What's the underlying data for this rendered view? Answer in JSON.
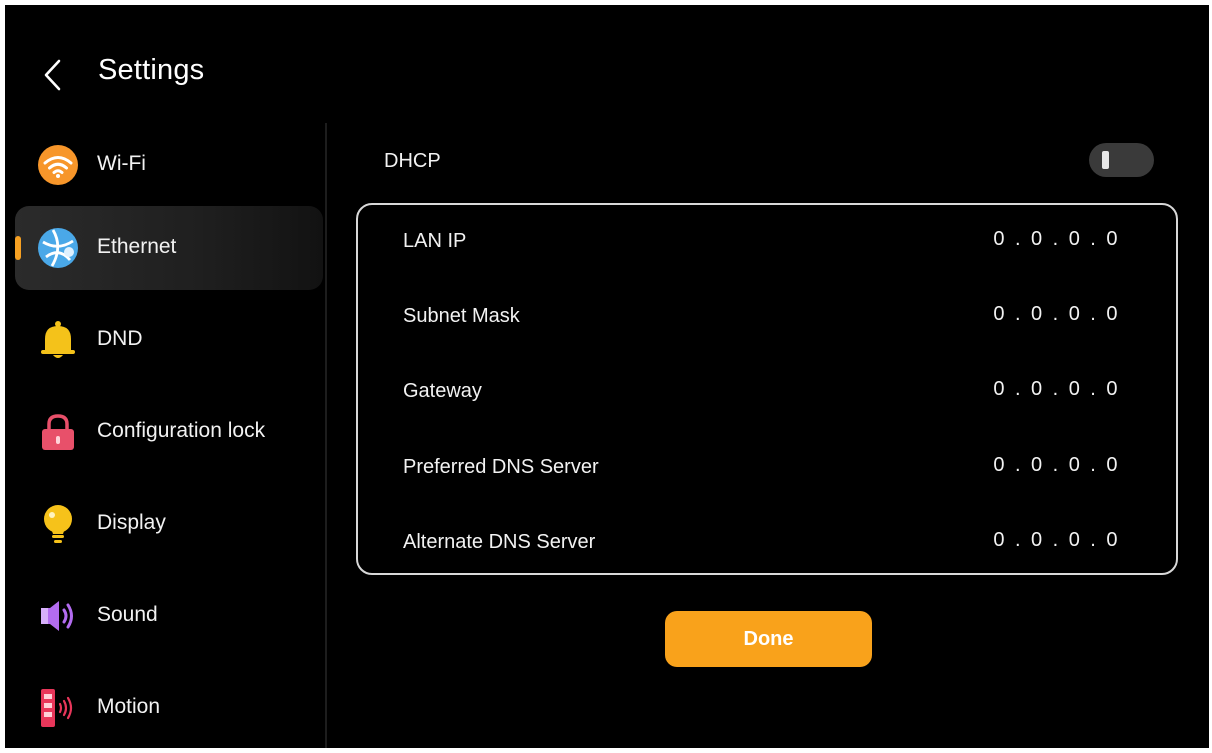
{
  "header": {
    "title": "Settings",
    "back_icon": "chevron-left-icon"
  },
  "sidebar": {
    "items": [
      {
        "label": "Wi-Fi",
        "icon": "wifi-icon",
        "active": false
      },
      {
        "label": "Ethernet",
        "icon": "ethernet-globe-icon",
        "active": true
      },
      {
        "label": "DND",
        "icon": "bell-icon",
        "active": false
      },
      {
        "label": "Configuration lock",
        "icon": "lock-icon",
        "active": false
      },
      {
        "label": "Display",
        "icon": "lightbulb-icon",
        "active": false
      },
      {
        "label": "Sound",
        "icon": "speaker-icon",
        "active": false
      },
      {
        "label": "Motion",
        "icon": "motion-sensor-icon",
        "active": false
      }
    ]
  },
  "content": {
    "dhcp": {
      "label": "DHCP",
      "enabled": false
    },
    "fields": [
      {
        "label": "LAN IP",
        "value": "0.0.0.0"
      },
      {
        "label": "Subnet Mask",
        "value": "0.0.0.0"
      },
      {
        "label": "Gateway",
        "value": "0.0.0.0"
      },
      {
        "label": "Preferred DNS Server",
        "value": "0.0.0.0"
      },
      {
        "label": "Alternate DNS Server",
        "value": "0.0.0.0"
      }
    ],
    "done_label": "Done"
  },
  "colors": {
    "background": "#000000",
    "accent": "#f9a21b",
    "wifi_icon": "#f7962a",
    "ethernet_icon": "#4aa8e8",
    "bell_icon": "#f4c21a",
    "lock_icon": "#e8506a",
    "display_icon": "#f6c21a",
    "sound_icon": "#b36cf0",
    "motion_icon": "#e8365a"
  }
}
